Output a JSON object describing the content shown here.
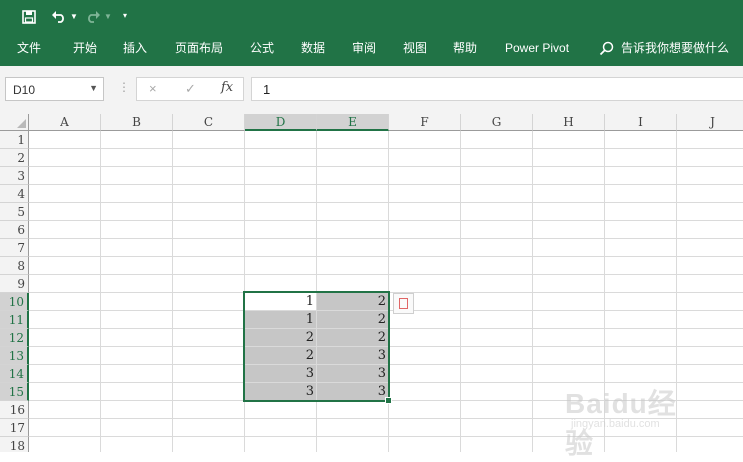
{
  "qat": {
    "save_icon": "save-icon",
    "undo_icon": "undo-icon",
    "redo_icon": "redo-icon",
    "customize_icon": "customize-qat-icon"
  },
  "ribbon": {
    "tabs": [
      "文件",
      "开始",
      "插入",
      "页面布局",
      "公式",
      "数据",
      "审阅",
      "视图",
      "帮助",
      "Power Pivot"
    ],
    "tell_me": "告诉我你想要做什么"
  },
  "formula_bar": {
    "name_box": "D10",
    "cancel_icon": "×",
    "enter_icon": "✓",
    "fx_label": "fx",
    "value": "1"
  },
  "sheet": {
    "columns": [
      "A",
      "B",
      "C",
      "D",
      "E",
      "F",
      "G",
      "H",
      "I",
      "J"
    ],
    "rows": [
      "1",
      "2",
      "3",
      "4",
      "5",
      "6",
      "7",
      "8",
      "9",
      "10",
      "11",
      "12",
      "13",
      "14",
      "15",
      "16",
      "17",
      "18"
    ],
    "selected_columns": [
      "D",
      "E"
    ],
    "selected_rows": [
      "10",
      "11",
      "12",
      "13",
      "14",
      "15"
    ],
    "active_cell": "D10",
    "cells": [
      {
        "ref": "D10",
        "value": "1"
      },
      {
        "ref": "E10",
        "value": "2"
      },
      {
        "ref": "D11",
        "value": "1"
      },
      {
        "ref": "E11",
        "value": "2"
      },
      {
        "ref": "D12",
        "value": "2"
      },
      {
        "ref": "E12",
        "value": "2"
      },
      {
        "ref": "D13",
        "value": "2"
      },
      {
        "ref": "E13",
        "value": "3"
      },
      {
        "ref": "D14",
        "value": "3"
      },
      {
        "ref": "E14",
        "value": "3"
      },
      {
        "ref": "D15",
        "value": "3"
      },
      {
        "ref": "E15",
        "value": "3"
      }
    ]
  },
  "watermark": {
    "text": "Baidu经验",
    "sub": "jingyan.baidu.com"
  },
  "colors": {
    "ribbon": "#217346",
    "selection_fill": "#c6c6c6",
    "header_selected": "#d2d2d2"
  }
}
